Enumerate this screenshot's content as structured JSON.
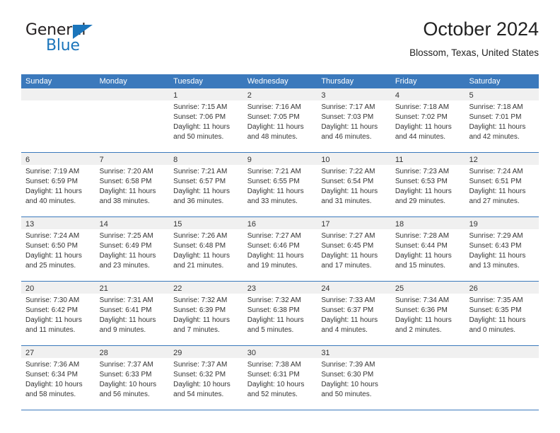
{
  "brand": {
    "name_part1": "General",
    "name_part2": "Blue",
    "accent_color": "#1b75bb"
  },
  "header": {
    "title": "October 2024",
    "location": "Blossom, Texas, United States"
  },
  "theme": {
    "header_blue": "#3b79bc",
    "day_band_gray": "#f0f0f0",
    "text_color": "#333333"
  },
  "weekdays": [
    "Sunday",
    "Monday",
    "Tuesday",
    "Wednesday",
    "Thursday",
    "Friday",
    "Saturday"
  ],
  "weeks": [
    [
      {
        "day": "",
        "sunrise": "",
        "sunset": "",
        "daylight_1": "",
        "daylight_2": ""
      },
      {
        "day": "",
        "sunrise": "",
        "sunset": "",
        "daylight_1": "",
        "daylight_2": ""
      },
      {
        "day": "1",
        "sunrise": "Sunrise: 7:15 AM",
        "sunset": "Sunset: 7:06 PM",
        "daylight_1": "Daylight: 11 hours",
        "daylight_2": "and 50 minutes."
      },
      {
        "day": "2",
        "sunrise": "Sunrise: 7:16 AM",
        "sunset": "Sunset: 7:05 PM",
        "daylight_1": "Daylight: 11 hours",
        "daylight_2": "and 48 minutes."
      },
      {
        "day": "3",
        "sunrise": "Sunrise: 7:17 AM",
        "sunset": "Sunset: 7:03 PM",
        "daylight_1": "Daylight: 11 hours",
        "daylight_2": "and 46 minutes."
      },
      {
        "day": "4",
        "sunrise": "Sunrise: 7:18 AM",
        "sunset": "Sunset: 7:02 PM",
        "daylight_1": "Daylight: 11 hours",
        "daylight_2": "and 44 minutes."
      },
      {
        "day": "5",
        "sunrise": "Sunrise: 7:18 AM",
        "sunset": "Sunset: 7:01 PM",
        "daylight_1": "Daylight: 11 hours",
        "daylight_2": "and 42 minutes."
      }
    ],
    [
      {
        "day": "6",
        "sunrise": "Sunrise: 7:19 AM",
        "sunset": "Sunset: 6:59 PM",
        "daylight_1": "Daylight: 11 hours",
        "daylight_2": "and 40 minutes."
      },
      {
        "day": "7",
        "sunrise": "Sunrise: 7:20 AM",
        "sunset": "Sunset: 6:58 PM",
        "daylight_1": "Daylight: 11 hours",
        "daylight_2": "and 38 minutes."
      },
      {
        "day": "8",
        "sunrise": "Sunrise: 7:21 AM",
        "sunset": "Sunset: 6:57 PM",
        "daylight_1": "Daylight: 11 hours",
        "daylight_2": "and 36 minutes."
      },
      {
        "day": "9",
        "sunrise": "Sunrise: 7:21 AM",
        "sunset": "Sunset: 6:55 PM",
        "daylight_1": "Daylight: 11 hours",
        "daylight_2": "and 33 minutes."
      },
      {
        "day": "10",
        "sunrise": "Sunrise: 7:22 AM",
        "sunset": "Sunset: 6:54 PM",
        "daylight_1": "Daylight: 11 hours",
        "daylight_2": "and 31 minutes."
      },
      {
        "day": "11",
        "sunrise": "Sunrise: 7:23 AM",
        "sunset": "Sunset: 6:53 PM",
        "daylight_1": "Daylight: 11 hours",
        "daylight_2": "and 29 minutes."
      },
      {
        "day": "12",
        "sunrise": "Sunrise: 7:24 AM",
        "sunset": "Sunset: 6:51 PM",
        "daylight_1": "Daylight: 11 hours",
        "daylight_2": "and 27 minutes."
      }
    ],
    [
      {
        "day": "13",
        "sunrise": "Sunrise: 7:24 AM",
        "sunset": "Sunset: 6:50 PM",
        "daylight_1": "Daylight: 11 hours",
        "daylight_2": "and 25 minutes."
      },
      {
        "day": "14",
        "sunrise": "Sunrise: 7:25 AM",
        "sunset": "Sunset: 6:49 PM",
        "daylight_1": "Daylight: 11 hours",
        "daylight_2": "and 23 minutes."
      },
      {
        "day": "15",
        "sunrise": "Sunrise: 7:26 AM",
        "sunset": "Sunset: 6:48 PM",
        "daylight_1": "Daylight: 11 hours",
        "daylight_2": "and 21 minutes."
      },
      {
        "day": "16",
        "sunrise": "Sunrise: 7:27 AM",
        "sunset": "Sunset: 6:46 PM",
        "daylight_1": "Daylight: 11 hours",
        "daylight_2": "and 19 minutes."
      },
      {
        "day": "17",
        "sunrise": "Sunrise: 7:27 AM",
        "sunset": "Sunset: 6:45 PM",
        "daylight_1": "Daylight: 11 hours",
        "daylight_2": "and 17 minutes."
      },
      {
        "day": "18",
        "sunrise": "Sunrise: 7:28 AM",
        "sunset": "Sunset: 6:44 PM",
        "daylight_1": "Daylight: 11 hours",
        "daylight_2": "and 15 minutes."
      },
      {
        "day": "19",
        "sunrise": "Sunrise: 7:29 AM",
        "sunset": "Sunset: 6:43 PM",
        "daylight_1": "Daylight: 11 hours",
        "daylight_2": "and 13 minutes."
      }
    ],
    [
      {
        "day": "20",
        "sunrise": "Sunrise: 7:30 AM",
        "sunset": "Sunset: 6:42 PM",
        "daylight_1": "Daylight: 11 hours",
        "daylight_2": "and 11 minutes."
      },
      {
        "day": "21",
        "sunrise": "Sunrise: 7:31 AM",
        "sunset": "Sunset: 6:41 PM",
        "daylight_1": "Daylight: 11 hours",
        "daylight_2": "and 9 minutes."
      },
      {
        "day": "22",
        "sunrise": "Sunrise: 7:32 AM",
        "sunset": "Sunset: 6:39 PM",
        "daylight_1": "Daylight: 11 hours",
        "daylight_2": "and 7 minutes."
      },
      {
        "day": "23",
        "sunrise": "Sunrise: 7:32 AM",
        "sunset": "Sunset: 6:38 PM",
        "daylight_1": "Daylight: 11 hours",
        "daylight_2": "and 5 minutes."
      },
      {
        "day": "24",
        "sunrise": "Sunrise: 7:33 AM",
        "sunset": "Sunset: 6:37 PM",
        "daylight_1": "Daylight: 11 hours",
        "daylight_2": "and 4 minutes."
      },
      {
        "day": "25",
        "sunrise": "Sunrise: 7:34 AM",
        "sunset": "Sunset: 6:36 PM",
        "daylight_1": "Daylight: 11 hours",
        "daylight_2": "and 2 minutes."
      },
      {
        "day": "26",
        "sunrise": "Sunrise: 7:35 AM",
        "sunset": "Sunset: 6:35 PM",
        "daylight_1": "Daylight: 11 hours",
        "daylight_2": "and 0 minutes."
      }
    ],
    [
      {
        "day": "27",
        "sunrise": "Sunrise: 7:36 AM",
        "sunset": "Sunset: 6:34 PM",
        "daylight_1": "Daylight: 10 hours",
        "daylight_2": "and 58 minutes."
      },
      {
        "day": "28",
        "sunrise": "Sunrise: 7:37 AM",
        "sunset": "Sunset: 6:33 PM",
        "daylight_1": "Daylight: 10 hours",
        "daylight_2": "and 56 minutes."
      },
      {
        "day": "29",
        "sunrise": "Sunrise: 7:37 AM",
        "sunset": "Sunset: 6:32 PM",
        "daylight_1": "Daylight: 10 hours",
        "daylight_2": "and 54 minutes."
      },
      {
        "day": "30",
        "sunrise": "Sunrise: 7:38 AM",
        "sunset": "Sunset: 6:31 PM",
        "daylight_1": "Daylight: 10 hours",
        "daylight_2": "and 52 minutes."
      },
      {
        "day": "31",
        "sunrise": "Sunrise: 7:39 AM",
        "sunset": "Sunset: 6:30 PM",
        "daylight_1": "Daylight: 10 hours",
        "daylight_2": "and 50 minutes."
      },
      {
        "day": "",
        "sunrise": "",
        "sunset": "",
        "daylight_1": "",
        "daylight_2": ""
      },
      {
        "day": "",
        "sunrise": "",
        "sunset": "",
        "daylight_1": "",
        "daylight_2": ""
      }
    ]
  ]
}
